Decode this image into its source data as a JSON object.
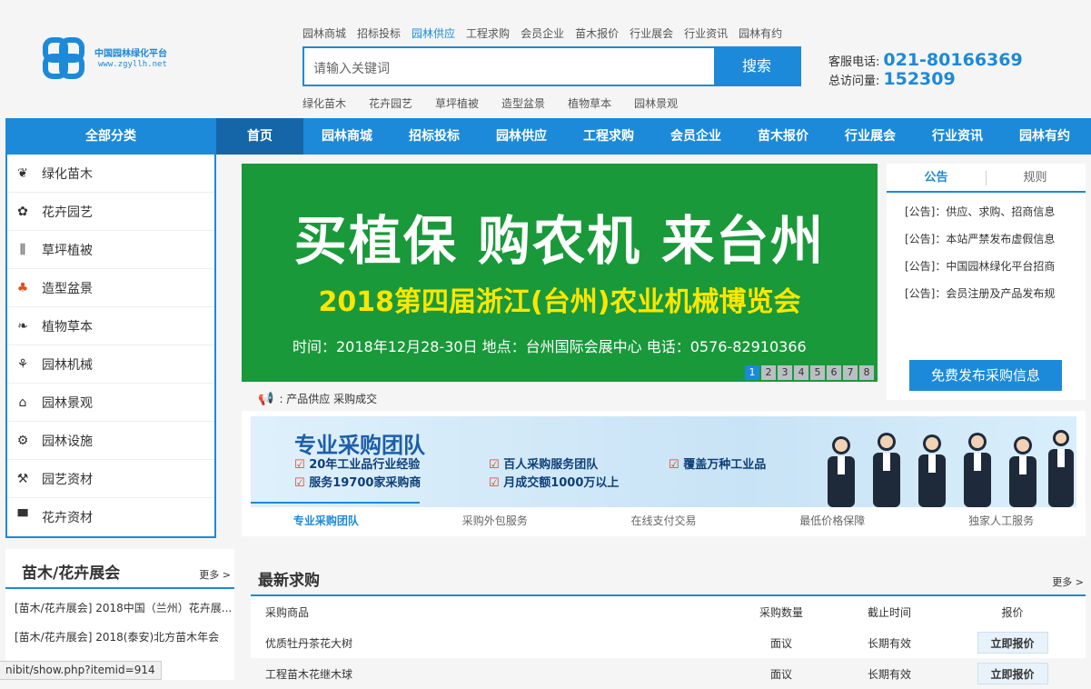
{
  "logo": {
    "name": "中国园林绿化平台",
    "url": "www.zgyllh.net"
  },
  "top_nav": [
    "园林商城",
    "招标投标",
    "园林供应",
    "工程求购",
    "会员企业",
    "苗木报价",
    "行业展会",
    "行业资讯",
    "园林有约"
  ],
  "search": {
    "placeholder": "请输入关键词",
    "button": "搜索"
  },
  "hot_words": [
    "绿化苗木",
    "花卉园艺",
    "草坪植被",
    "造型盆景",
    "植物草本",
    "园林景观"
  ],
  "contact": {
    "phone_label": "客服电话:",
    "phone": "021-80166369",
    "visits_label": "总访问量:",
    "visits": "152309"
  },
  "main_nav": {
    "all_label": "全部分类",
    "items": [
      "首页",
      "园林商城",
      "招标投标",
      "园林供应",
      "工程求购",
      "会员企业",
      "苗木报价",
      "行业展会",
      "行业资讯",
      "园林有约"
    ]
  },
  "categories": [
    {
      "label": "绿化苗木",
      "icon": "seedling-icon"
    },
    {
      "label": "花卉园艺",
      "icon": "flower-icon"
    },
    {
      "label": "草坪植被",
      "icon": "grass-icon"
    },
    {
      "label": "造型盆景",
      "icon": "bonsai-icon"
    },
    {
      "label": "植物草本",
      "icon": "leaf-icon"
    },
    {
      "label": "园林机械",
      "icon": "machine-icon"
    },
    {
      "label": "园林景观",
      "icon": "landscape-icon"
    },
    {
      "label": "园林设施",
      "icon": "gear-icon"
    },
    {
      "label": "园艺资材",
      "icon": "tool-icon"
    },
    {
      "label": "花卉资材",
      "icon": "pot-icon"
    }
  ],
  "banner": {
    "headline": "买植保 购农机 来台州",
    "subtitle": "2018第四届浙江(台州)农业机械博览会",
    "info": "时间：2018年12月28-30日    地点：台州国际会展中心    电话：0576-82910366",
    "pages": [
      "1",
      "2",
      "3",
      "4",
      "5",
      "6",
      "7",
      "8"
    ],
    "active_page": "1"
  },
  "notice": {
    "tabs": [
      "公告",
      "规则"
    ],
    "items": [
      "[公告]：供应、求购、招商信息",
      "[公告]：本站严禁发布虚假信息",
      "[公告]：中国园林绿化平台招商",
      "[公告]：会员注册及产品发布规"
    ],
    "publish_button": "免费发布采购信息"
  },
  "ticker": {
    "label": ": 产品供应  采购成交"
  },
  "promo": {
    "title": "专业采购团队",
    "features": [
      "20年工业品行业经验",
      "百人采购服务团队",
      "覆盖万种工业品",
      "服务19700家采购商",
      "月成交额1000万以上"
    ],
    "tabs": [
      "专业采购团队",
      "采购外包服务",
      "在线支付交易",
      "最低价格保障",
      "独家人工服务"
    ]
  },
  "expo": {
    "title": "苗木/花卉展会",
    "more": "更多 >",
    "items": [
      "[苗木/花卉展会] 2018中国（兰州）花卉展...",
      "[苗木/花卉展会] 2018(泰安)北方苗木年会"
    ]
  },
  "latest": {
    "title": "最新求购",
    "more": "更多 >",
    "columns": [
      "采购商品",
      "采购数量",
      "截止时间",
      "报价"
    ],
    "rows": [
      {
        "name": "优质牡丹茶花大树",
        "qty": "面议",
        "deadline": "长期有效",
        "action": "立即报价"
      },
      {
        "name": "工程苗木花继木球",
        "qty": "面议",
        "deadline": "长期有效",
        "action": "立即报价"
      }
    ]
  },
  "status_bar": "nibit/show.php?itemid=914",
  "colors": {
    "brand": "#1c8ad8",
    "banner_bg": "#19993a",
    "banner_accent": "#ffe600"
  }
}
